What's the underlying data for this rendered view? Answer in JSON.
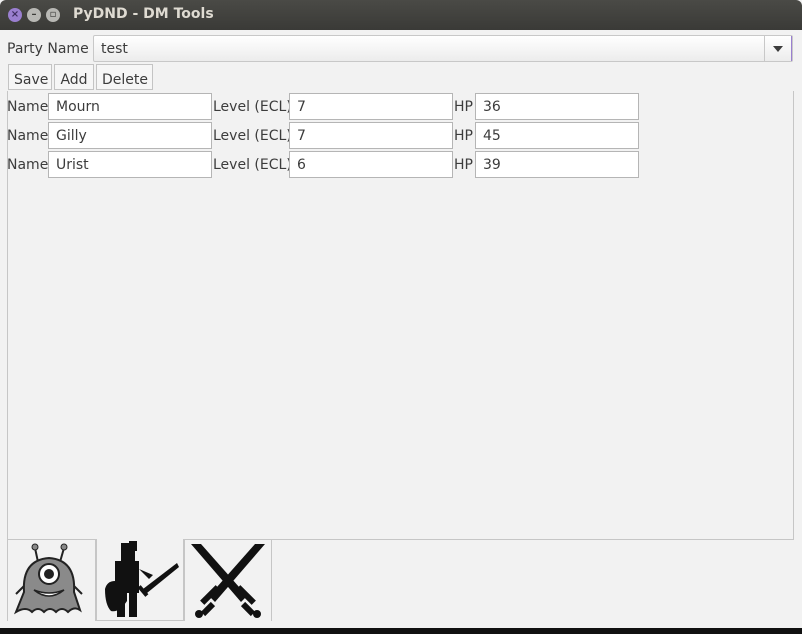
{
  "window": {
    "title": "PyDND - DM Tools"
  },
  "party": {
    "label": "Party Name",
    "selected": "test"
  },
  "toolbar": {
    "save_label": "Save",
    "add_label": "Add",
    "delete_label": "Delete"
  },
  "members": [
    {
      "name_label": "Name",
      "name": "Mourn",
      "level_label": "Level (ECL)",
      "level": "7",
      "hp_label": "HP",
      "hp": "36"
    },
    {
      "name_label": "Name",
      "name": "Gilly",
      "level_label": "Level (ECL)",
      "level": "7",
      "hp_label": "HP",
      "hp": "45"
    },
    {
      "name_label": "Name",
      "name": "Urist",
      "level_label": "Level (ECL)",
      "level": "6",
      "hp_label": "HP",
      "hp": "39"
    }
  ],
  "tabs": [
    {
      "icon": "monster-icon"
    },
    {
      "icon": "knight-icon"
    },
    {
      "icon": "crossed-swords-icon"
    }
  ]
}
